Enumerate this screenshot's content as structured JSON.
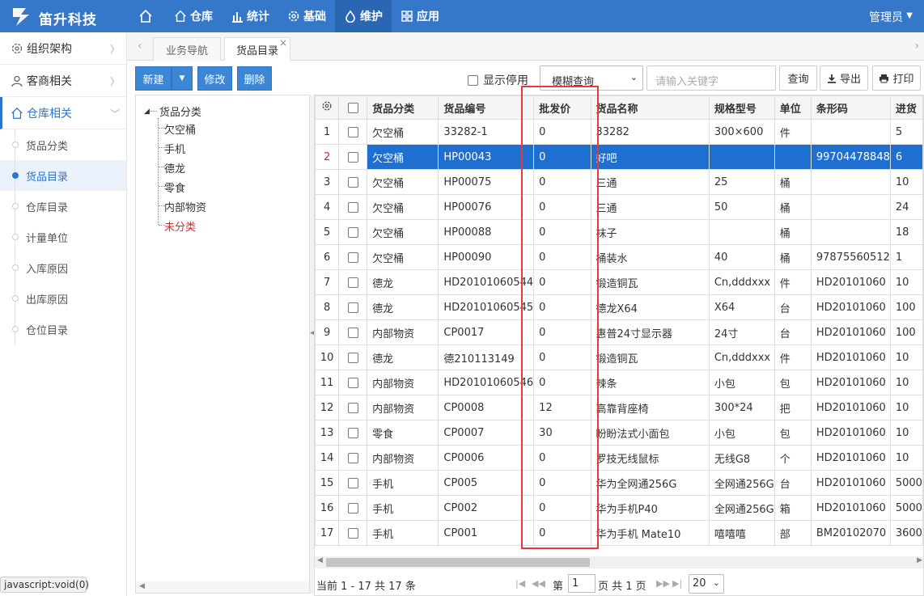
{
  "header": {
    "brand": "笛升科技",
    "user": "管理员",
    "nav": [
      {
        "label": "",
        "icon": "home-icon"
      },
      {
        "label": "仓库",
        "icon": "home-icon"
      },
      {
        "label": "统计",
        "icon": "bar-chart-icon"
      },
      {
        "label": "基础",
        "icon": "gear-icon"
      },
      {
        "label": "维护",
        "icon": "droplet-icon",
        "active": true
      },
      {
        "label": "应用",
        "icon": "grid-icon"
      }
    ]
  },
  "sidebar": {
    "groups": [
      {
        "label": "组织架构",
        "icon": "gear-icon"
      },
      {
        "label": "客商相关",
        "icon": "user-icon"
      },
      {
        "label": "仓库相关",
        "icon": "home-icon",
        "open": true
      }
    ],
    "items": [
      {
        "label": "货品分类"
      },
      {
        "label": "货品目录",
        "active": true
      },
      {
        "label": "仓库目录"
      },
      {
        "label": "计量单位"
      },
      {
        "label": "入库原因"
      },
      {
        "label": "出库原因"
      },
      {
        "label": "仓位目录"
      }
    ]
  },
  "status_text": "javascript:void(0)",
  "tabs": [
    {
      "label": "业务导航"
    },
    {
      "label": "货品目录",
      "active": true,
      "close": "×"
    }
  ],
  "toolbar": {
    "new": "新建",
    "edit": "修改",
    "delete": "删除",
    "show_disabled": "显示停用",
    "query_mode": "模糊查询",
    "keyword_placeholder": "请输入关键字",
    "query": "查询",
    "export": "导出",
    "print": "打印"
  },
  "tree": {
    "root": "货品分类",
    "nodes": [
      "欠空桶",
      "手机",
      "德龙",
      "零食",
      "内部物资",
      "未分类"
    ],
    "selected": "未分类"
  },
  "table": {
    "columns": [
      "货品分类",
      "货品编号",
      "批发价",
      "货品名称",
      "规格型号",
      "单位",
      "条形码",
      "进货"
    ],
    "rows": [
      [
        "1",
        "欠空桶",
        "33282-1",
        "0",
        "33282",
        "300×600",
        "件",
        "",
        "5"
      ],
      [
        "2",
        "欠空桶",
        "HP00043",
        "0",
        "好吧",
        "",
        "",
        "99704478848",
        "6"
      ],
      [
        "3",
        "欠空桶",
        "HP00075",
        "0",
        "三通",
        "25",
        "桶",
        "",
        "10"
      ],
      [
        "4",
        "欠空桶",
        "HP00076",
        "0",
        "三通",
        "50",
        "桶",
        "",
        "24"
      ],
      [
        "5",
        "欠空桶",
        "HP00088",
        "0",
        "袜子",
        "",
        "桶",
        "",
        "18"
      ],
      [
        "6",
        "欠空桶",
        "HP00090",
        "0",
        "桶装水",
        "40",
        "桶",
        "97875560512",
        "1"
      ],
      [
        "7",
        "德龙",
        "HD20101060544",
        "0",
        "锻造铜瓦",
        "Cn,dddxxx",
        "件",
        "HD20101060",
        "10"
      ],
      [
        "8",
        "德龙",
        "HD20101060545",
        "0",
        "德龙X64",
        "X64",
        "台",
        "HD20101060",
        "100"
      ],
      [
        "9",
        "内部物资",
        "CP0017",
        "0",
        "惠普24寸显示器",
        "24寸",
        "台",
        "HD20101060",
        "100"
      ],
      [
        "10",
        "德龙",
        "德210113149",
        "0",
        "锻造铜瓦",
        "Cn,dddxxx",
        "件",
        "HD20101060",
        "10"
      ],
      [
        "11",
        "内部物资",
        "HD20101060546",
        "0",
        "辣条",
        "小包",
        "包",
        "HD20101060",
        "10"
      ],
      [
        "12",
        "内部物资",
        "CP0008",
        "12",
        "高靠背座椅",
        "300*24",
        "把",
        "HD20101060",
        "10"
      ],
      [
        "13",
        "零食",
        "CP0007",
        "30",
        "盼盼法式小面包",
        "小包",
        "包",
        "HD20101060",
        "10"
      ],
      [
        "14",
        "内部物资",
        "CP0006",
        "0",
        "罗技无线鼠标",
        "无线G8",
        "个",
        "HD20101060",
        "10"
      ],
      [
        "15",
        "手机",
        "CP005",
        "0",
        "华为全网通256G",
        "全网通256G",
        "台",
        "HD20101060",
        "5000"
      ],
      [
        "16",
        "手机",
        "CP002",
        "0",
        "华为手机P40",
        "全网通256G",
        "箱",
        "HD20101060",
        "5000"
      ],
      [
        "17",
        "手机",
        "CP001",
        "0",
        "华为手机 Mate10",
        "嘻嘻嘻",
        "部",
        "BM20102070",
        "3600"
      ]
    ],
    "selected_row": 2
  },
  "pager": {
    "info": "当前 1 - 17 共 17 条",
    "page_label": "第",
    "page_value": "1",
    "total_label": "页 共 1 页",
    "page_size": "20"
  },
  "colors": {
    "topbar": "#3577c9",
    "accent": "#2f74c8",
    "selected_row": "#1f6fd0",
    "highlight_box": "#e63a3a",
    "selected_tree": "#d9262c"
  }
}
